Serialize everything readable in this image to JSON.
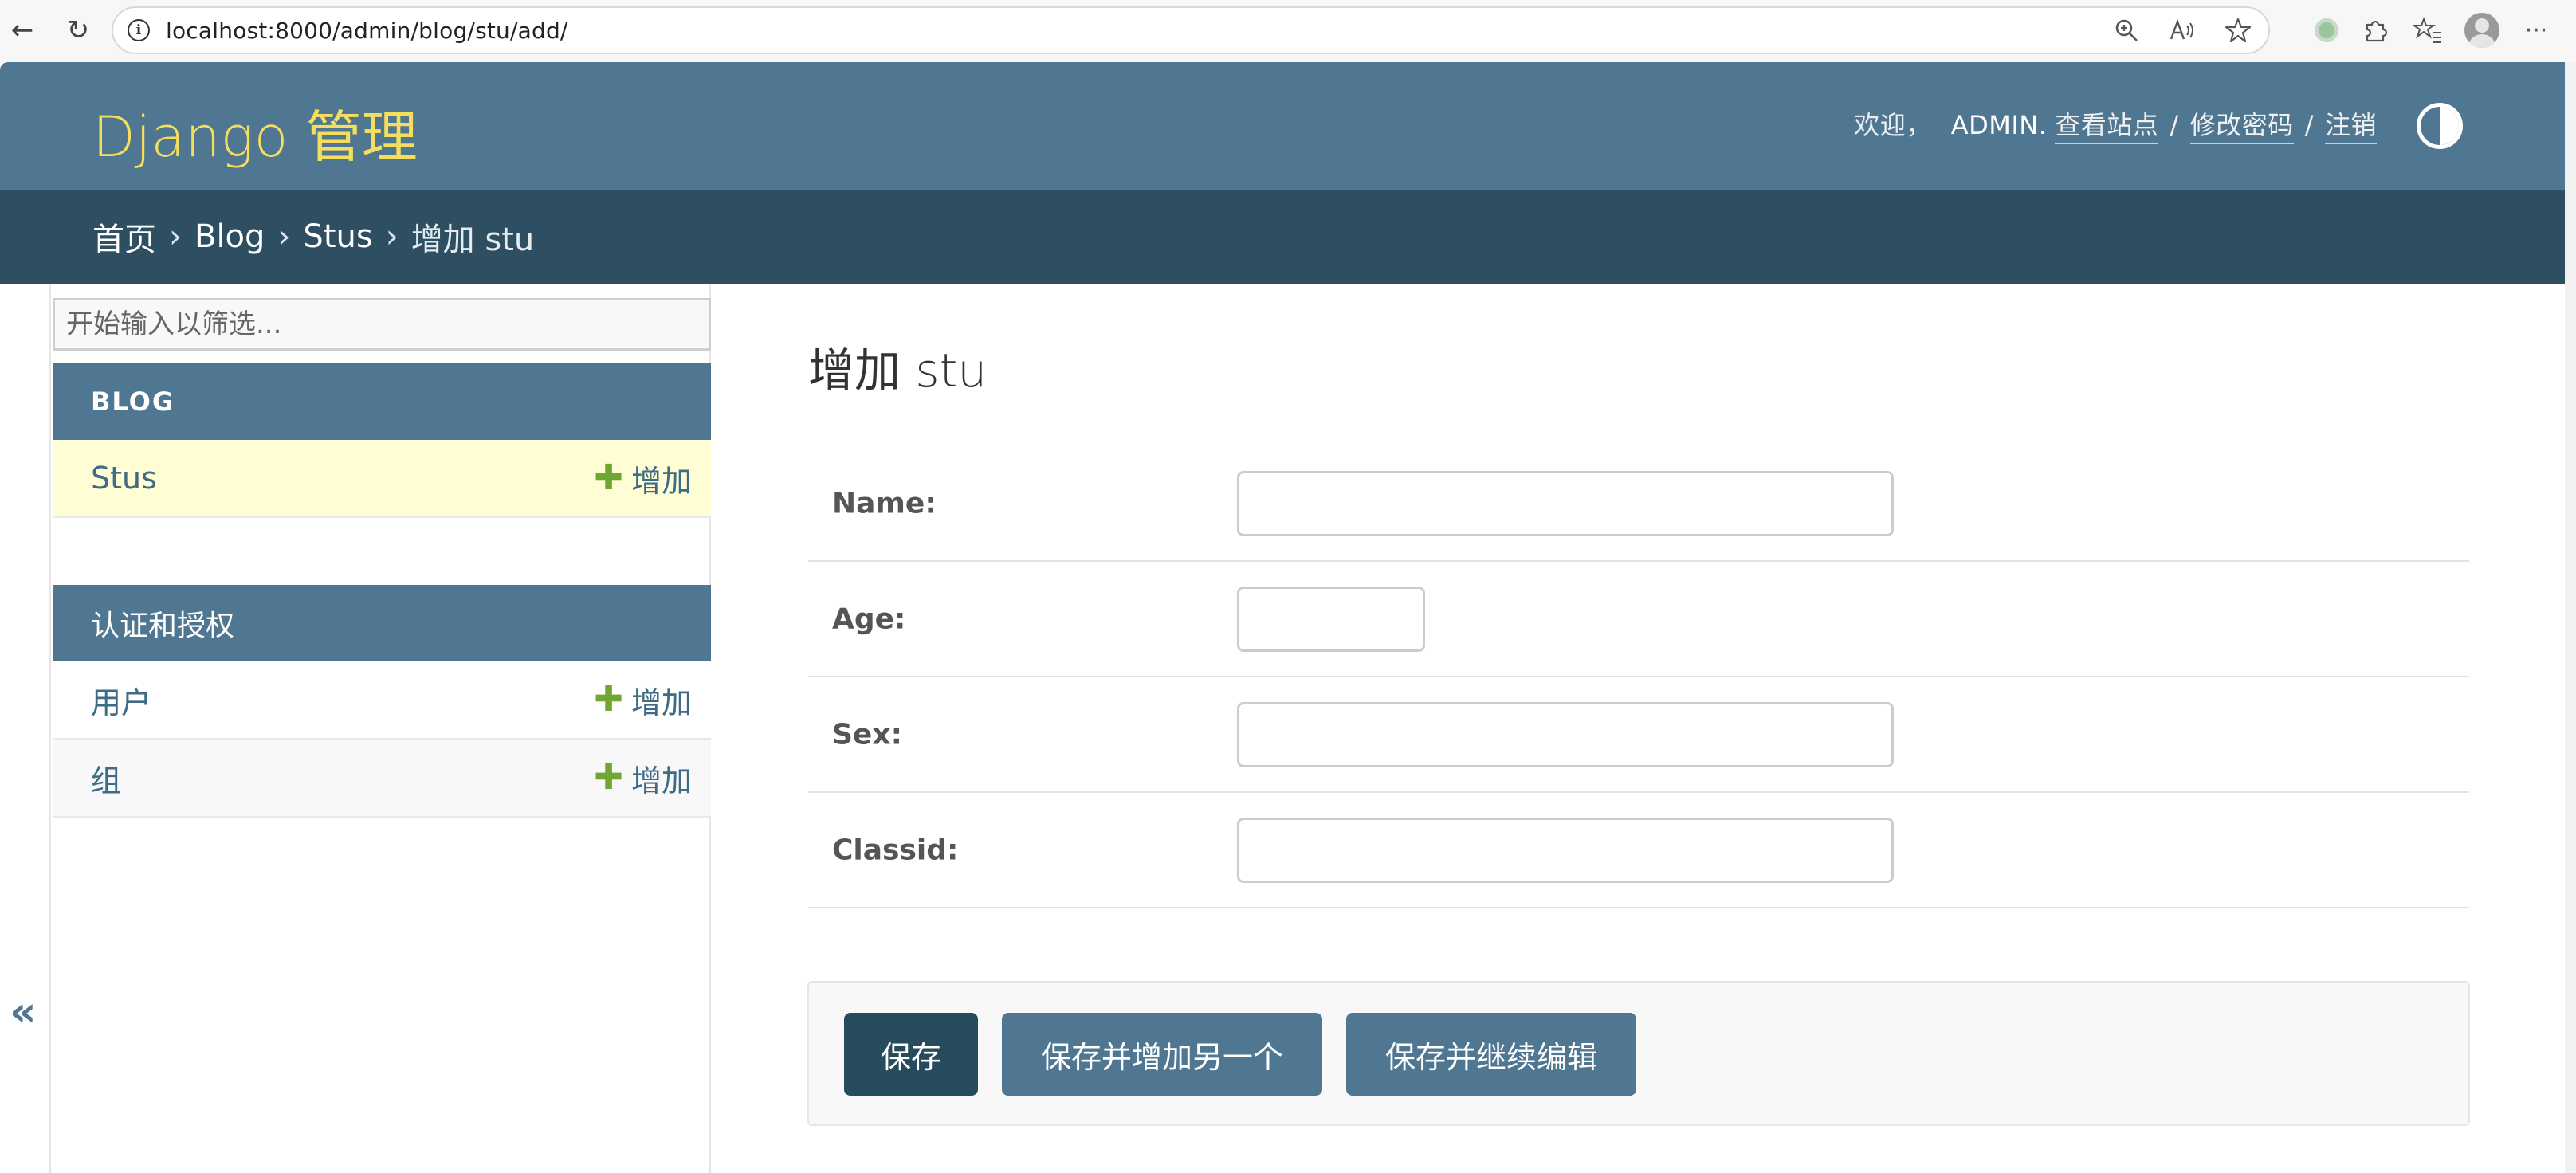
{
  "browser": {
    "url": "localhost:8000/admin/blog/stu/add/",
    "info_glyph": "i",
    "back_glyph": "←",
    "reload_glyph": "↻",
    "menu_glyph": "···"
  },
  "header": {
    "branding": "Django 管理",
    "welcome": "欢迎，",
    "username": "ADMIN.",
    "view_site": "查看站点",
    "change_password": "修改密码",
    "logout": "注销",
    "separator": "/"
  },
  "breadcrumbs": {
    "home": "首页",
    "app": "Blog",
    "model": "Stus",
    "current": "增加 stu",
    "separator": "›"
  },
  "sidebar": {
    "filter_placeholder": "开始输入以筛选...",
    "apps": [
      {
        "name": "BLOG",
        "models": [
          {
            "name": "Stus",
            "add_label": "增加",
            "current": true
          }
        ]
      },
      {
        "name": "认证和授权",
        "models": [
          {
            "name": "用户",
            "add_label": "增加"
          },
          {
            "name": "组",
            "add_label": "增加"
          }
        ]
      }
    ],
    "collapse_glyph": "«",
    "plus_glyph": "✚"
  },
  "content": {
    "title": "增加 stu",
    "fields": [
      {
        "label": "Name:",
        "value": ""
      },
      {
        "label": "Age:",
        "value": ""
      },
      {
        "label": "Sex:",
        "value": ""
      },
      {
        "label": "Classid:",
        "value": ""
      }
    ],
    "buttons": {
      "save": "保存",
      "save_add_another": "保存并增加另一个",
      "save_continue": "保存并继续编辑"
    }
  },
  "colors": {
    "header_bg": "#4f7791",
    "breadcrumb_bg": "#2e4f61",
    "branding": "#f5dd5d",
    "current_row_bg": "#fffdd4",
    "add_icon": "#70a731",
    "link": "#3e6b85",
    "save_button": "#264b5d"
  }
}
